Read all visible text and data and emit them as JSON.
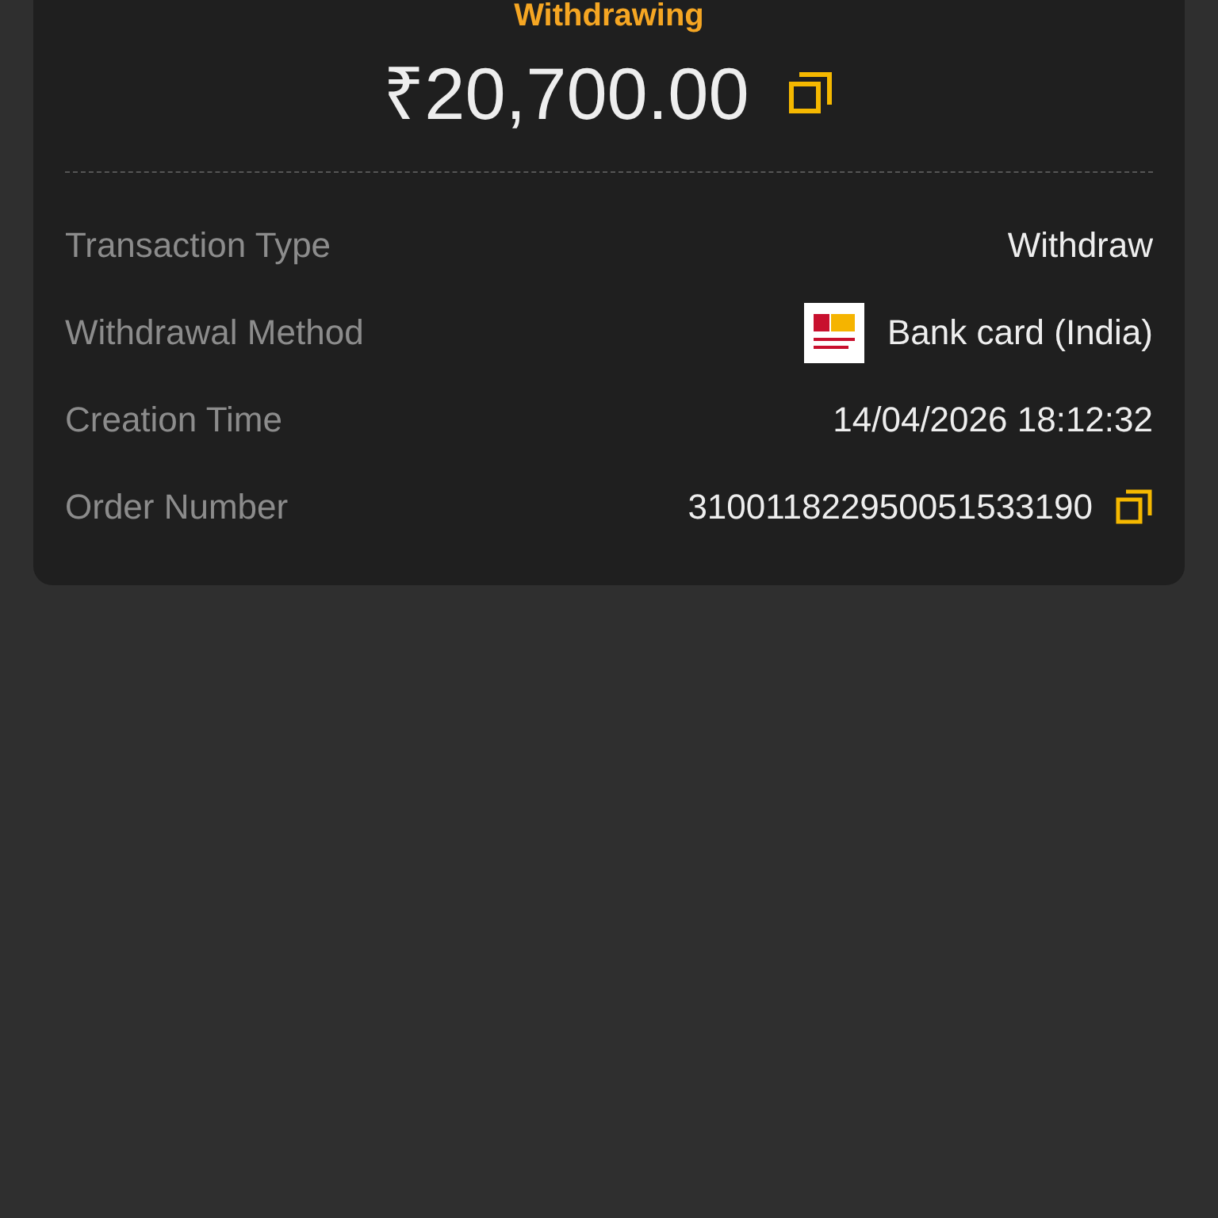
{
  "status": "Withdrawing",
  "amount": "₹20,700.00",
  "details": [
    {
      "label": "Transaction Type",
      "value": "Withdraw",
      "kind": "text"
    },
    {
      "label": "Withdrawal Method",
      "value": "Bank card (India)",
      "kind": "bank"
    },
    {
      "label": "Creation Time",
      "value": "14/04/2026 18:12:32",
      "kind": "text"
    },
    {
      "label": "Order Number",
      "value": "310011822950051533190",
      "kind": "copy"
    }
  ]
}
